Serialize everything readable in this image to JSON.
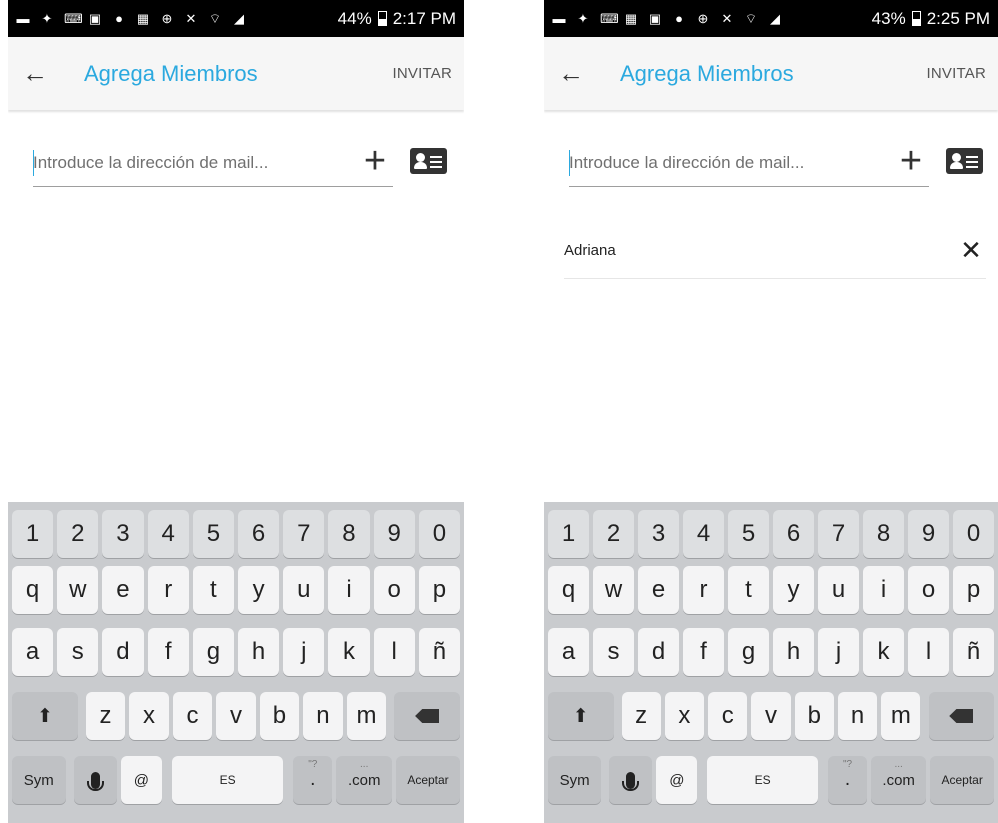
{
  "screens": [
    {
      "statusbar": {
        "icons": [
          "messenger-icon",
          "twitter-icon",
          "keyboard-icon",
          "gallery-icon",
          "skype-icon",
          "screen-icon",
          "add-contact-icon",
          "mute-icon",
          "wifi-icon",
          "signal-icon"
        ],
        "battery_text": "44%",
        "battery_level": 0.44,
        "time": "2:17 PM"
      },
      "appbar": {
        "title": "Agrega Miembros",
        "action": "INVITAR"
      },
      "email_input": {
        "placeholder": "Introduce la dirección de mail...",
        "value": ""
      },
      "members": [],
      "keyboard": {
        "number_row": [
          "1",
          "2",
          "3",
          "4",
          "5",
          "6",
          "7",
          "8",
          "9",
          "0"
        ],
        "row1": [
          "q",
          "w",
          "e",
          "r",
          "t",
          "y",
          "u",
          "i",
          "o",
          "p"
        ],
        "row2": [
          "a",
          "s",
          "d",
          "f",
          "g",
          "h",
          "j",
          "k",
          "l",
          "ñ"
        ],
        "row3": [
          "z",
          "x",
          "c",
          "v",
          "b",
          "n",
          "m"
        ],
        "sym": "Sym",
        "at": "@",
        "space": "ES",
        "period": ".",
        "period_hint": "\"?",
        "dotcom": ".com",
        "dotcom_hint": "...",
        "enter": "Aceptar"
      }
    },
    {
      "statusbar": {
        "icons": [
          "messenger-icon",
          "twitter-icon",
          "keyboard-icon",
          "screen-icon",
          "gallery-icon",
          "skype-icon",
          "add-contact-icon",
          "mute-icon",
          "wifi-icon",
          "signal-icon"
        ],
        "battery_text": "43%",
        "battery_level": 0.43,
        "time": "2:25 PM"
      },
      "appbar": {
        "title": "Agrega Miembros",
        "action": "INVITAR"
      },
      "email_input": {
        "placeholder": "Introduce la dirección de mail...",
        "value": ""
      },
      "members": [
        {
          "name": "Adriana"
        }
      ],
      "keyboard": {
        "number_row": [
          "1",
          "2",
          "3",
          "4",
          "5",
          "6",
          "7",
          "8",
          "9",
          "0"
        ],
        "row1": [
          "q",
          "w",
          "e",
          "r",
          "t",
          "y",
          "u",
          "i",
          "o",
          "p"
        ],
        "row2": [
          "a",
          "s",
          "d",
          "f",
          "g",
          "h",
          "j",
          "k",
          "l",
          "ñ"
        ],
        "row3": [
          "z",
          "x",
          "c",
          "v",
          "b",
          "n",
          "m"
        ],
        "sym": "Sym",
        "at": "@",
        "space": "ES",
        "period": ".",
        "period_hint": "\"?",
        "dotcom": ".com",
        "dotcom_hint": "...",
        "enter": "Aceptar"
      }
    }
  ],
  "colors": {
    "accent": "#2ba9df",
    "statusbar": "#000000",
    "keyboard_bg": "#c9cbce",
    "key": "#f4f4f5"
  }
}
